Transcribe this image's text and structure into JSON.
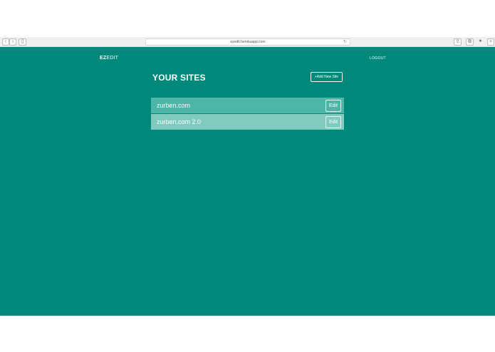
{
  "browser": {
    "url": "ezedit.herokuapp.com",
    "back": "‹",
    "forward": "›",
    "sidebar_icon": "▯",
    "reload_icon": "↻",
    "share_icon": "⇪",
    "tabs_icon": "⧉",
    "ext_icon": "●",
    "new_tab_icon": "+"
  },
  "nav": {
    "logo_bold": "EZ",
    "logo_rest": "EDIT",
    "logout": "LOGOUT"
  },
  "main": {
    "title": "YOUR SITES",
    "add_button": "+Add New Site",
    "sites": [
      {
        "name": "zurben.com",
        "edit": "Edit"
      },
      {
        "name": "zurben.com 2.0",
        "edit": "Edit"
      }
    ]
  },
  "colors": {
    "background": "#00897b",
    "row1": "#4db6a6",
    "row2": "#80cbc0"
  }
}
